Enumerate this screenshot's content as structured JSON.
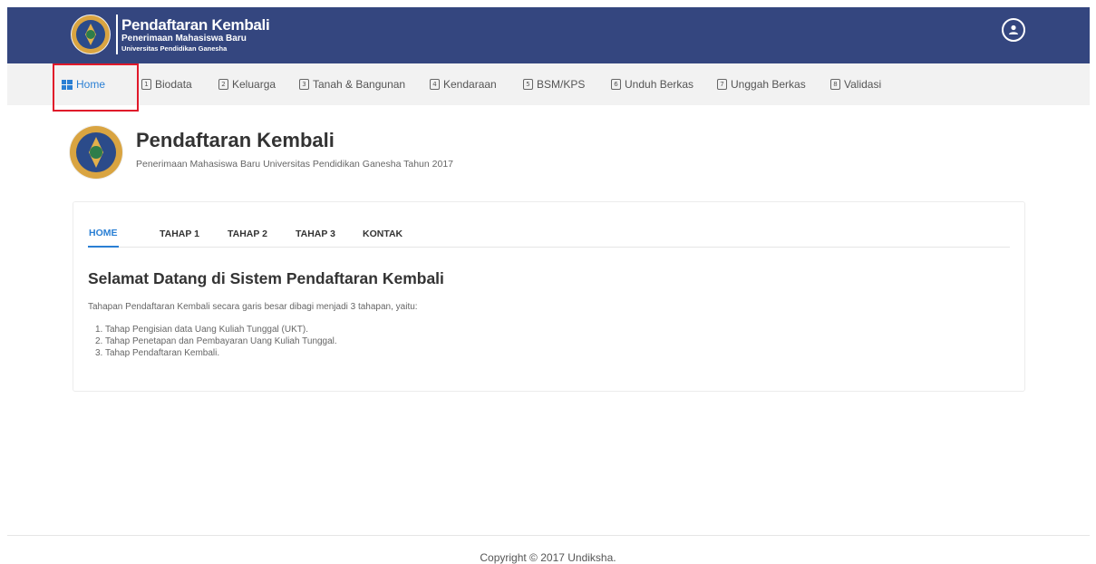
{
  "header": {
    "title": "Pendaftaran Kembali",
    "subtitle1": "Penerimaan Mahasiswa Baru",
    "subtitle2": "Universitas Pendidikan Ganesha"
  },
  "nav": {
    "items": [
      {
        "label": "Home",
        "icon": "home-icon",
        "active": true
      },
      {
        "label": "Biodata",
        "icon": "1"
      },
      {
        "label": "Keluarga",
        "icon": "2"
      },
      {
        "label": "Tanah & Bangunan",
        "icon": "3"
      },
      {
        "label": "Kendaraan",
        "icon": "4"
      },
      {
        "label": "BSM/KPS",
        "icon": "5"
      },
      {
        "label": "Unduh Berkas",
        "icon": "6"
      },
      {
        "label": "Unggah Berkas",
        "icon": "7"
      },
      {
        "label": "Validasi",
        "icon": "8"
      }
    ]
  },
  "page": {
    "title": "Pendaftaran Kembali",
    "subtitle": "Penerimaan Mahasiswa Baru Universitas Pendidikan Ganesha Tahun 2017"
  },
  "tabs": [
    {
      "label": "HOME",
      "active": true
    },
    {
      "label": "TAHAP 1"
    },
    {
      "label": "TAHAP 2"
    },
    {
      "label": "TAHAP 3"
    },
    {
      "label": "KONTAK"
    }
  ],
  "content": {
    "heading": "Selamat Datang di Sistem Pendaftaran Kembali",
    "intro": "Tahapan Pendaftaran Kembali secara garis besar dibagi menjadi 3 tahapan, yaitu:",
    "steps": [
      "1. Tahap Pengisian data Uang Kuliah Tunggal (UKT).",
      "2. Tahap Penetapan dan Pembayaran Uang Kuliah Tunggal.",
      "3. Tahap Pendaftaran Kembali."
    ]
  },
  "footer": {
    "copyright": "Copyright © 2017 Undiksha."
  },
  "colors": {
    "header_bg": "#34467f",
    "accent": "#2a7fd4",
    "highlight": "#e0192a"
  }
}
